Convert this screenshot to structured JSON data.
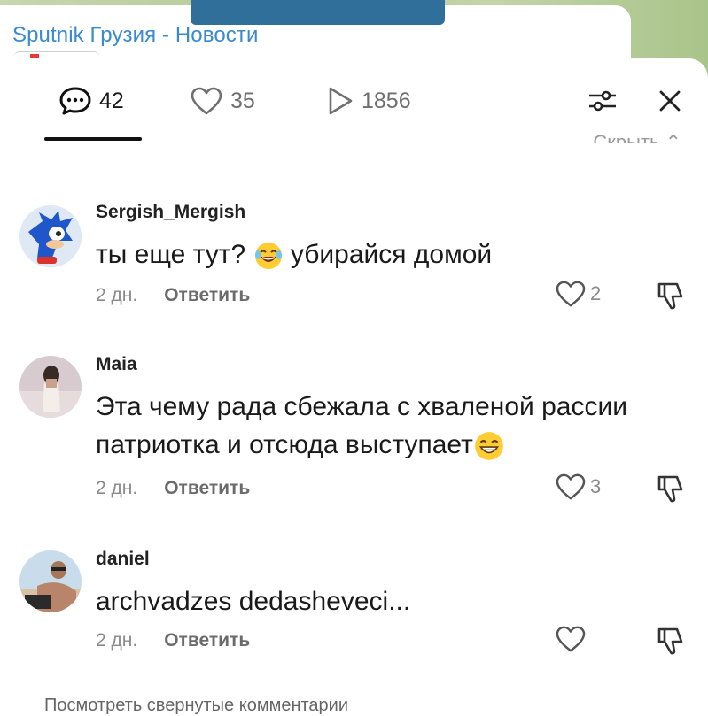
{
  "channel": {
    "title": "Sputnik Грузия - Новости"
  },
  "tabs": {
    "comments_count": "42",
    "likes_count": "35",
    "views_count": "1856"
  },
  "hide_label": "Скрыть",
  "comments": [
    {
      "username": "Sergish_Mergish",
      "text_before": "ты еще тут?",
      "text_after": "убирайся домой",
      "emoji": "laughing-tears",
      "age": "2 дн.",
      "reply_label": "Ответить",
      "likes": "2"
    },
    {
      "username": "Maia",
      "text_line1": "Эта чему рада сбежала с хваленой рассии",
      "text_line2": "патриотка и отсюда выступает",
      "emoji": "grinning",
      "age": "2 дн.",
      "reply_label": "Ответить",
      "likes": "3"
    },
    {
      "username": "daniel",
      "text": "archvadzes dedasheveci...",
      "age": "2 дн.",
      "reply_label": "Ответить",
      "likes": ""
    }
  ],
  "footer": {
    "peek_text": "Посмотреть свернутые комментарии"
  },
  "colors": {
    "accent_link": "#3a8ad0",
    "text": "#1a1a1a",
    "muted": "#8a8a8a"
  }
}
